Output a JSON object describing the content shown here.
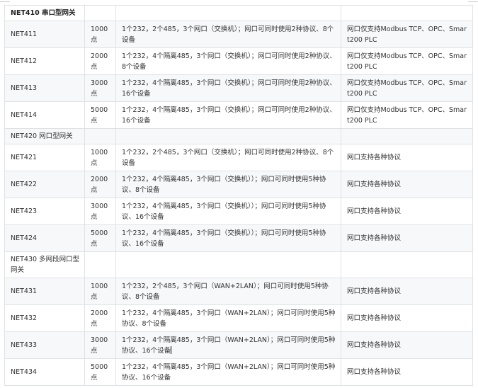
{
  "rows": [
    {
      "kind": "group",
      "model": "NET410 串口型网关",
      "points": "",
      "ports": "",
      "protocol": "",
      "h": 22
    },
    {
      "kind": "item",
      "model": "NET411",
      "points": "1000点",
      "ports": "1个232，2个485，3个网口（交换机）；网口可同时使用2种协议、8个设备",
      "protocol": "网口仅支持Modbus TCP、OPC、Smart200 PLC",
      "h": 38
    },
    {
      "kind": "item",
      "model": "NET412",
      "points": "2000点",
      "ports": "1个232，4个隔离485，3个网口（交换机）；网口可同时使用2种协议、8个设备",
      "protocol": "网口仅支持Modbus TCP、OPC、Smart200 PLC",
      "h": 38
    },
    {
      "kind": "item",
      "model": "NET413",
      "points": "3000点",
      "ports": "1个232，4个隔离485，3个网口（交换机）；网口可同时使用2种协议、16个设备",
      "protocol": "网口仅支持Modbus TCP、OPC、Smart200 PLC",
      "h": 38
    },
    {
      "kind": "item",
      "model": "NET414",
      "points": "5000点",
      "ports": "1个232，4个隔离485，3个网口（交换机）；网口可同时使用2种协议、16个设备",
      "protocol": "网口仅支持Modbus TCP、OPC、Smart200 PLC",
      "h": 38
    },
    {
      "kind": "group",
      "model": "NET420 网口型网关",
      "points": "",
      "ports": "",
      "protocol": "",
      "h": 22
    },
    {
      "kind": "item",
      "model": "NET421",
      "points": "1000点",
      "ports": "1个232，2个485，3个网口（交换机）；网口可同时使用2种协议、8个设备",
      "protocol": "网口支持各种协议",
      "h": 38
    },
    {
      "kind": "item",
      "model": "NET422",
      "points": "2000点",
      "ports": "1个232，4个隔离485，3个网口（交换机））；网口可同时使用5种协议、8个设备",
      "protocol": "网口支持各种协议",
      "h": 38
    },
    {
      "kind": "item",
      "model": "NET423",
      "points": "3000点",
      "ports": "1个232，4个隔离485，3个网口（交换机））；网口可同时使用5种协议、16个设备",
      "protocol": "网口支持各种协议",
      "h": 38
    },
    {
      "kind": "item",
      "model": "NET424",
      "points": "5000点",
      "ports": "1个232，4个隔离485，3个网口（交换机））；网口可同时使用5种协议、16个设备",
      "protocol": "网口支持各种协议",
      "h": 38
    },
    {
      "kind": "group",
      "model": "NET430 多网段网口型网关",
      "points": "",
      "ports": "",
      "protocol": "",
      "h": 37
    },
    {
      "kind": "item",
      "model": "NET431",
      "points": "1000点",
      "ports": "1个232，2个485，3个网口（WAN+2LAN）；网口可同时使用5种协议、8个设备",
      "protocol": "网口支持各种协议",
      "h": 38
    },
    {
      "kind": "item",
      "model": "NET432",
      "points": "2000点",
      "ports": "1个232，4个隔离485，3个网口（WAN+2LAN）；网口可同时使用5种协议、8个设备",
      "protocol": "网口支持各种协议",
      "h": 38
    },
    {
      "kind": "item",
      "model": "NET433",
      "points": "3000点",
      "ports": "1个232，4个隔离485，3个网口（WAN+2LAN）；网口可同时使用5种协议、16个设备",
      "protocol": "网口支持各种协议",
      "h": 38,
      "cursor": true
    },
    {
      "kind": "item",
      "model": "NET434",
      "points": "5000点",
      "ports": "1个232，4个隔离485，3个网口（WAN+2LAN）；网口可同时使用5种协议、16个设备",
      "protocol": "网口支持各种协议",
      "h": 38
    }
  ]
}
